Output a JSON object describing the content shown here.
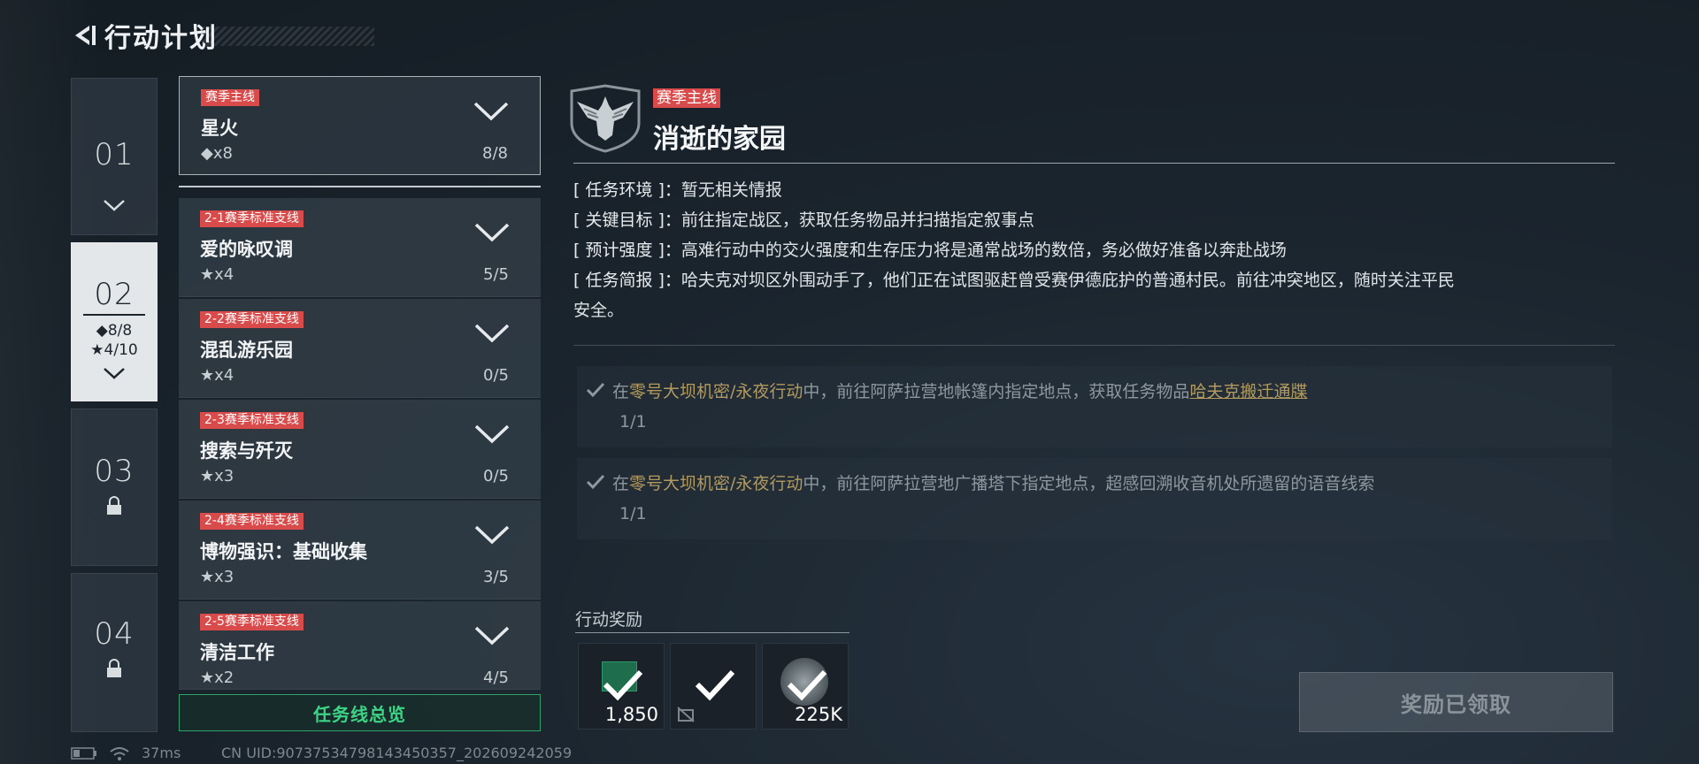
{
  "header": {
    "title": "行动计划"
  },
  "chapters": [
    {
      "num": "01"
    },
    {
      "num": "02",
      "stat1": "◆8/8",
      "stat2": "★4/10"
    },
    {
      "num": "03"
    },
    {
      "num": "04"
    }
  ],
  "missions": [
    {
      "tag": "赛季主线",
      "name": "星火",
      "reward": "◆x8",
      "progress": "8/8"
    },
    {
      "tag": "2-1赛季标准支线",
      "name": "爱的咏叹调",
      "reward": "★x4",
      "progress": "5/5"
    },
    {
      "tag": "2-2赛季标准支线",
      "name": "混乱游乐园",
      "reward": "★x4",
      "progress": "0/5"
    },
    {
      "tag": "2-3赛季标准支线",
      "name": "搜索与歼灭",
      "reward": "★x3",
      "progress": "0/5"
    },
    {
      "tag": "2-4赛季标准支线",
      "name": "博物强识：基础收集",
      "reward": "★x3",
      "progress": "3/5"
    },
    {
      "tag": "2-5赛季标准支线",
      "name": "清洁工作",
      "reward": "★x2",
      "progress": "4/5"
    }
  ],
  "overview_label": "任务线总览",
  "detail": {
    "tag": "赛季主线",
    "title": "消逝的家园",
    "env_label": "[ 任务环境 ]：",
    "env": "暂无相关情报",
    "goal_label": "[ 关键目标 ]：",
    "goal": "前往指定战区，获取任务物品并扫描指定叙事点",
    "intensity_label": "[ 预计强度 ]：",
    "intensity": "高难行动中的交火强度和生存压力将是通常战场的数倍，务必做好准备以奔赴战场",
    "brief_label": "[ 任务简报 ]：",
    "brief1": "哈夫克对坝区外围动手了，他们正在试图驱赶曾受赛伊德庇护的普通村民。前往冲突地区，随时关注平民",
    "brief2": "安全。"
  },
  "objectives": [
    {
      "pre": "在",
      "map": "零号大坝机密/永夜行动",
      "mid": "中，前往阿萨拉营地帐篷内指定地点，获取任务物品",
      "item": "哈夫克搬迁通牒",
      "count": "1/1"
    },
    {
      "pre": "在",
      "map": "零号大坝机密/永夜行动",
      "mid": "中，前往阿萨拉营地广播塔下指定地点，超感回溯收音机处所遗留的语音线索",
      "item": "",
      "count": "1/1"
    }
  ],
  "rewards": {
    "label": "行动奖励",
    "items": [
      {
        "amount": "1,850"
      },
      {
        "amount": ""
      },
      {
        "amount": "225K"
      }
    ]
  },
  "claim_label": "奖励已领取",
  "status": {
    "ping": "37ms",
    "uid": "CN UID:9073753479814345035​7_202609242059"
  }
}
